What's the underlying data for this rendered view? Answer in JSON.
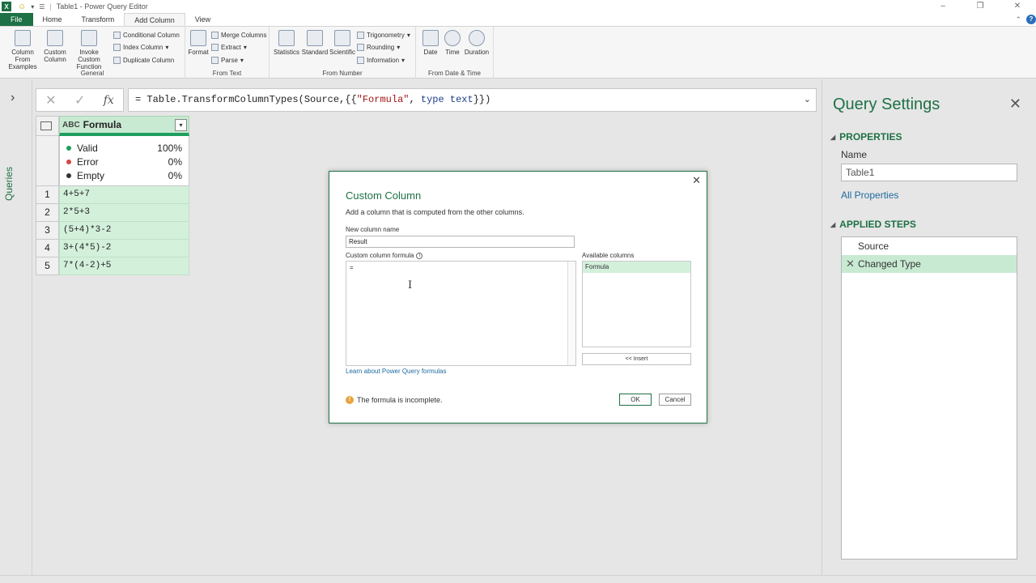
{
  "titlebar": {
    "app_icon": "X",
    "title": "Table1 - Power Query Editor",
    "window_buttons": [
      "–",
      "❐",
      "✕"
    ]
  },
  "menu": {
    "tabs": [
      "File",
      "Home",
      "Transform",
      "Add Column",
      "View"
    ]
  },
  "ribbon": {
    "general": {
      "label": "General",
      "column_from_examples": "Column From Examples",
      "custom_column": "Custom Column",
      "invoke_custom_function": "Invoke Custom Function",
      "conditional_column": "Conditional Column",
      "index_column": "Index Column",
      "duplicate_column": "Duplicate Column"
    },
    "from_text": {
      "label": "From Text",
      "format": "Format",
      "merge_columns": "Merge Columns",
      "extract": "Extract",
      "parse": "Parse"
    },
    "from_number": {
      "label": "From Number",
      "statistics": "Statistics",
      "standard": "Standard",
      "scientific": "Scientific",
      "trigonometry": "Trigonometry",
      "rounding": "Rounding",
      "information": "Information"
    },
    "from_date_time": {
      "label": "From Date & Time",
      "date": "Date",
      "time": "Time",
      "duration": "Duration"
    }
  },
  "queries_panel": {
    "label": "Queries"
  },
  "formula_bar": {
    "prefix": "= Table.TransformColumnTypes(Source,{{",
    "string": "\"Formula\"",
    "sep": ", ",
    "kw1": "type",
    "kw2": "text",
    "suffix": "}})"
  },
  "grid": {
    "column_name": "Formula",
    "type_icon": "ABC",
    "profile": [
      {
        "label": "Valid",
        "pct": "100%",
        "color": "#1e9e5e"
      },
      {
        "label": "Error",
        "pct": "0%",
        "color": "#d64545"
      },
      {
        "label": "Empty",
        "pct": "0%",
        "color": "#333333"
      }
    ],
    "rows": [
      {
        "n": "1",
        "v": "4+5+7"
      },
      {
        "n": "2",
        "v": "2*5+3"
      },
      {
        "n": "3",
        "v": "(5+4)*3-2"
      },
      {
        "n": "4",
        "v": "3+(4*5)-2"
      },
      {
        "n": "5",
        "v": "7*(4-2)+5"
      }
    ]
  },
  "dialog": {
    "title": "Custom Column",
    "subtitle": "Add a column that is computed from the other columns.",
    "name_label": "New column name",
    "name_value": "Result",
    "formula_label": "Custom column formula",
    "formula_value": "=",
    "available_label": "Available columns",
    "available_columns": [
      "Formula"
    ],
    "insert": "<< Insert",
    "learn_link": "Learn about Power Query formulas",
    "warning": "The formula is incomplete.",
    "ok": "OK",
    "cancel": "Cancel"
  },
  "settings": {
    "title": "Query Settings",
    "properties": "PROPERTIES",
    "name_label": "Name",
    "name_value": "Table1",
    "all_properties": "All Properties",
    "applied_steps": "APPLIED STEPS",
    "steps": [
      "Source",
      "Changed Type"
    ]
  },
  "colors": {
    "accent": "#1e7145",
    "selection": "#c8ead2"
  }
}
